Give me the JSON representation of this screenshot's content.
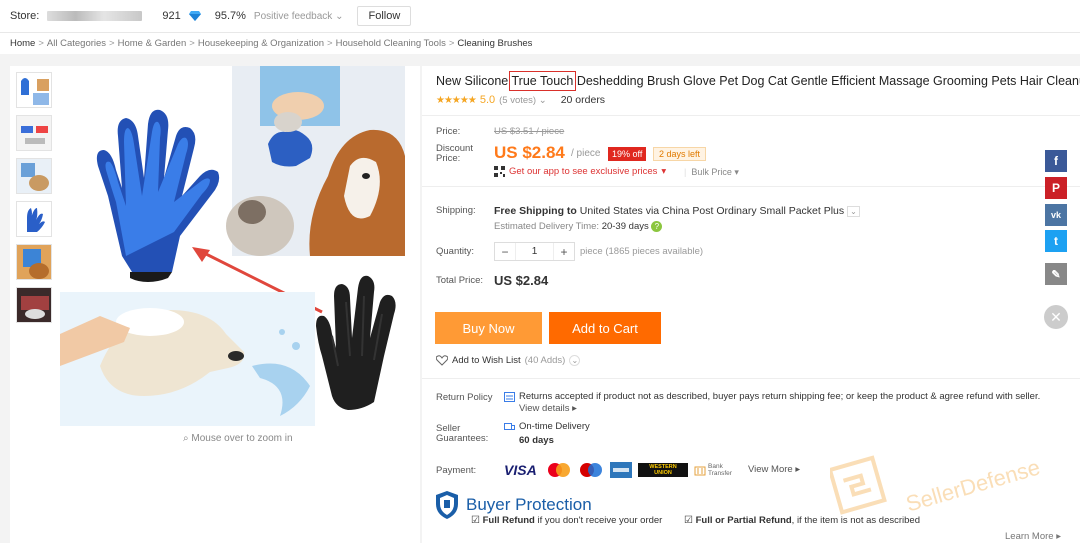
{
  "store": {
    "label": "Store:",
    "score": "921",
    "positive": "95.7%",
    "feedback": "Positive feedback",
    "follow": "Follow"
  },
  "breadcrumb": [
    "Home",
    "All Categories",
    "Home & Garden",
    "Housekeeping & Organization",
    "Household Cleaning Tools",
    "Cleaning Brushes"
  ],
  "gallery": {
    "zoom_hint": "Mouse over to zoom in"
  },
  "product": {
    "title_pre": "New Silicone ",
    "title_highlight": "True Touch",
    "title_post": " Deshedding Brush Glove Pet Dog Cat Gentle Efficient Massage Grooming Pets Hair Cleanup",
    "rating": "5.0",
    "votes": "(5 votes)",
    "orders": "20 orders",
    "price_label": "Price:",
    "old_price": "US $3.51 / piece",
    "discount_label_1": "Discount",
    "discount_label_2": "Price:",
    "price": "US $2.84",
    "unit": "/ piece",
    "off": "19% off",
    "days_left": "2 days left",
    "app_promo": "Get our app to see exclusive prices",
    "bulk": "Bulk Price",
    "shipping_label": "Shipping:",
    "shipping_bold": "Free Shipping to",
    "shipping_rest": "United States via China Post Ordinary Small Packet Plus",
    "delivery_label": "Estimated Delivery Time:",
    "delivery_value": "20-39",
    "delivery_unit": "days",
    "quantity_label": "Quantity:",
    "quantity": "1",
    "available": "piece (1865 pieces available)",
    "total_label": "Total Price:",
    "total": "US $2.84",
    "buy_now": "Buy Now",
    "add_to_cart": "Add to Cart",
    "wishlist": "Add to Wish List",
    "wishlist_count": "(40 Adds)",
    "return_label": "Return Policy",
    "return_text": "Returns accepted if product not as described, buyer pays return shipping fee; or keep the product & agree refund with seller.",
    "view_details": "View details",
    "guarantee_label_1": "Seller",
    "guarantee_label_2": "Guarantees:",
    "ontime": "On-time Delivery",
    "ontime_days": "60 days",
    "payment_label": "Payment:",
    "view_more": "View More",
    "bp_title": "Buyer Protection",
    "bp_full": "Full Refund",
    "bp_full_rest": "if you don't receive your order",
    "bp_partial": "Full or Partial Refund",
    "bp_partial_rest": ", if the item is not as described",
    "learn_more": "Learn More"
  },
  "payment_logos": [
    "VISA",
    "WESTERN UNION",
    "Bank Transfer"
  ],
  "watermark": "SellerDefense",
  "colors": {
    "accent": "#ff6a00",
    "price": "#ff7a1a",
    "buy_now": "#ff9a35",
    "bp_blue": "#1a5ea8"
  }
}
